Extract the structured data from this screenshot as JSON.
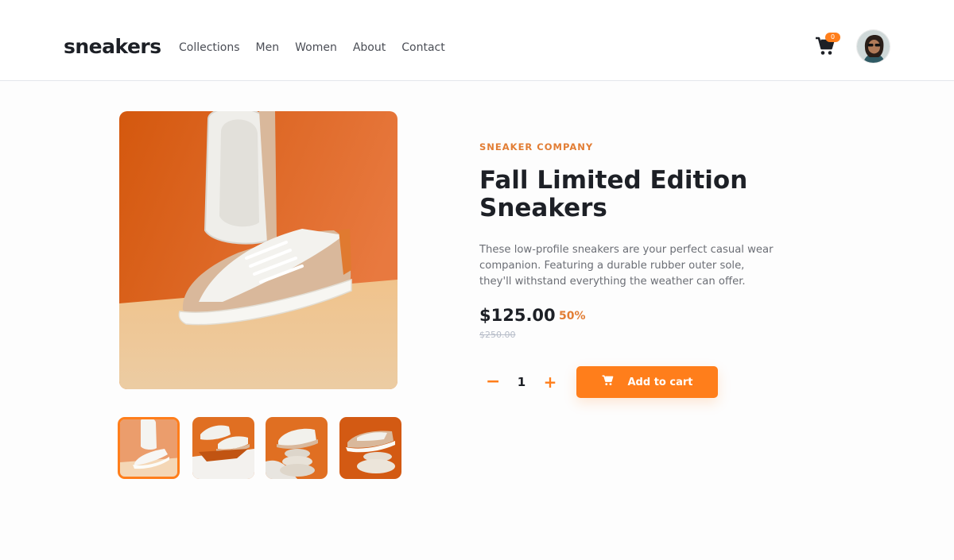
{
  "header": {
    "logo": "sneakers",
    "nav": [
      "Collections",
      "Men",
      "Women",
      "About",
      "Contact"
    ],
    "cart_count": "0",
    "cart_icon": "cart-icon",
    "avatar_icon": "user-avatar"
  },
  "product": {
    "company": "SNEAKER COMPANY",
    "title_line1": "Fall Limited Edition",
    "title_line2": "Sneakers",
    "description": "These low-profile sneakers are your perfect casual wear companion. Featuring a durable rubber outer sole, they'll withstand everything the weather can offer.",
    "price": "$125.00",
    "discount": "50%",
    "old_price": "$250.00"
  },
  "cart_controls": {
    "minus_label": "−",
    "quantity": "1",
    "plus_label": "+",
    "add_label": "Add to cart"
  },
  "colors": {
    "accent": "#ff7e1b",
    "text_dark": "#1d2026",
    "text_muted": "#6b6e75"
  }
}
